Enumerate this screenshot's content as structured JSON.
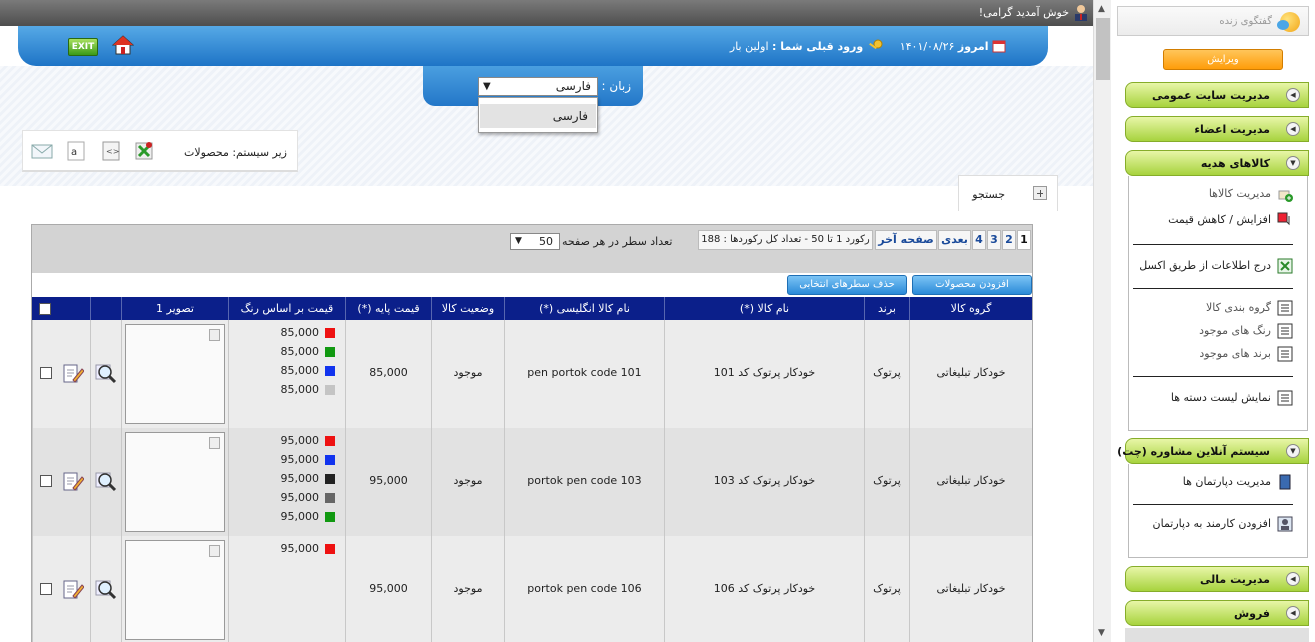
{
  "topbar": {
    "welcome": "خوش آمدید گرامی!"
  },
  "header": {
    "today_label": "امروز",
    "today_date": "۱۴۰۱/۰۸/۲۶",
    "last_login_label": "ورود قبلی شما :",
    "last_login_value": "اولین بار",
    "exit_label": "EXIT"
  },
  "language": {
    "label": "زبان :",
    "selected": "فارسی",
    "options": [
      "فارسی"
    ]
  },
  "toolbar": {
    "subsystem_label": "زیر سیستم: محصولات"
  },
  "search": {
    "label": "جستجو"
  },
  "pager": {
    "pages": [
      "1",
      "2",
      "3",
      "4"
    ],
    "next_label": "بعدی",
    "last_label": "صفحه آخر",
    "record_info": "رکورد 1 تا 50 - تعداد کل رکوردها : 188",
    "rows_label": "تعداد سطر در هر صفحه",
    "rows_value": "50"
  },
  "actions": {
    "add_label": "افزودن محصولات",
    "delete_label": "حذف سطرهای انتخابی"
  },
  "table": {
    "headers": [
      "گروه کالا",
      "برند",
      "نام کالا (*)",
      "نام کالا انگلیسی (*)",
      "وضعیت کالا",
      "قیمت پایه (*)",
      "قیمت بر اساس رنگ",
      "تصویر 1"
    ],
    "rows": [
      {
        "group": "خودکار تبلیغاتی",
        "brand": "پرتوک",
        "name": "خودکار پرتوک کد 101",
        "name_en": "pen portok code 101",
        "status": "موجود",
        "price": "85,000",
        "color_prices": [
          {
            "price": "85,000",
            "color": "#ee1111"
          },
          {
            "price": "85,000",
            "color": "#119911"
          },
          {
            "price": "85,000",
            "color": "#1133ee"
          },
          {
            "price": "85,000",
            "color": "#c4c4c4"
          }
        ]
      },
      {
        "group": "خودکار تبلیغاتی",
        "brand": "پرتوک",
        "name": "خودکار پرتوک کد 103",
        "name_en": "portok pen code 103",
        "status": "موجود",
        "price": "95,000",
        "color_prices": [
          {
            "price": "95,000",
            "color": "#ee1111"
          },
          {
            "price": "95,000",
            "color": "#1133ee"
          },
          {
            "price": "95,000",
            "color": "#222222"
          },
          {
            "price": "95,000",
            "color": "#666666"
          },
          {
            "price": "95,000",
            "color": "#119911"
          }
        ]
      },
      {
        "group": "خودکار تبلیغاتی",
        "brand": "پرتوک",
        "name": "خودکار پرتوک کد 106",
        "name_en": "portok pen code 106",
        "status": "موجود",
        "price": "95,000",
        "color_prices": [
          {
            "price": "95,000",
            "color": "#ee1111"
          }
        ]
      }
    ]
  },
  "sidebar": {
    "chat_label": "گفتگوی زنده",
    "edit_label": "ویرایش",
    "sections": [
      {
        "label": "مدیریت سایت عمومی",
        "expanded": false
      },
      {
        "label": "مدیریت اعضاء",
        "expanded": false
      },
      {
        "label": "کالاهای هدیه",
        "expanded": true
      },
      {
        "label": "سیستم آنلاین مشاوره (چت)",
        "expanded": true
      },
      {
        "label": "مدیریت مالی",
        "expanded": false
      },
      {
        "label": "فروش",
        "expanded": false
      }
    ],
    "gifts_items": [
      "مدیریت کالاها",
      "افزایش / کاهش قیمت",
      "درج اطلاعات از طریق اکسل",
      "گروه بندی کالا",
      "رنگ های موجود",
      "برند های موجود",
      "نمایش لیست دسته ها"
    ],
    "chat_items": [
      "مدیریت دپارتمان ها",
      "افزودن کارمند به دپارتمان"
    ]
  }
}
